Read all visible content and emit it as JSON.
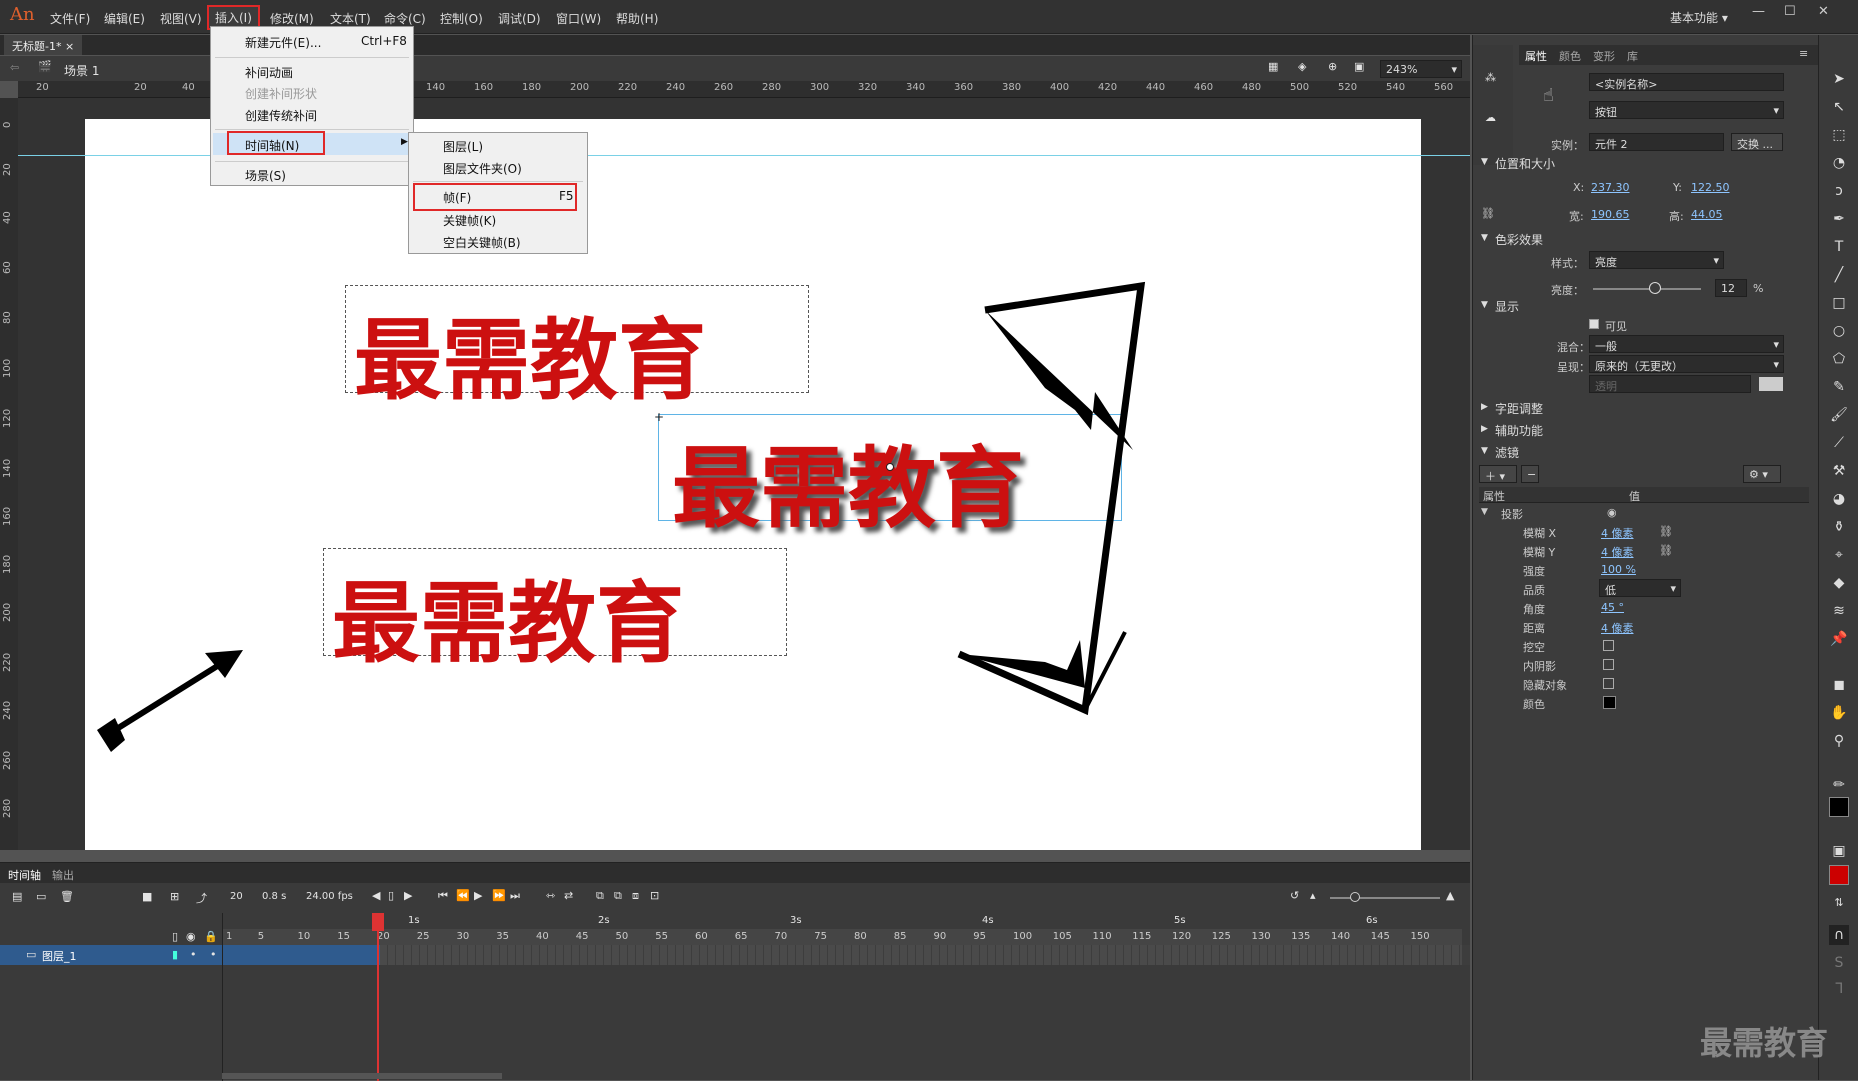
{
  "app": {
    "logo": "An"
  },
  "menubar": {
    "items": [
      "文件(F)",
      "编辑(E)",
      "视图(V)",
      "插入(I)",
      "修改(M)",
      "文本(T)",
      "命令(C)",
      "控制(O)",
      "调试(D)",
      "窗口(W)",
      "帮助(H)"
    ],
    "active": "插入(I)",
    "workspace": "基本功能"
  },
  "document": {
    "tab": "无标题-1*",
    "scene": "场景 1",
    "zoom": "243%"
  },
  "ruler": {
    "top": [
      "20",
      "20",
      "40",
      "140",
      "160",
      "180",
      "200",
      "220",
      "240",
      "260",
      "280",
      "300",
      "320",
      "340",
      "360",
      "380",
      "400",
      "420",
      "440",
      "460",
      "480",
      "500",
      "520",
      "540",
      "560"
    ],
    "left": [
      "0",
      "20",
      "40",
      "60",
      "80",
      "100",
      "120",
      "140",
      "160",
      "180",
      "200",
      "220",
      "240",
      "260",
      "280"
    ]
  },
  "insert_menu": {
    "items": [
      {
        "label": "新建元件(E)...",
        "shortcut": "Ctrl+F8"
      },
      {
        "label": "补间动画"
      },
      {
        "label": "创建补间形状",
        "disabled": true
      },
      {
        "label": "创建传统补间"
      },
      {
        "label": "时间轴(N)",
        "submenu": true
      },
      {
        "label": "场景(S)"
      }
    ]
  },
  "timeline_submenu": {
    "items": [
      {
        "label": "图层(L)"
      },
      {
        "label": "图层文件夹(O)"
      },
      {
        "label": "帧(F)",
        "shortcut": "F5"
      },
      {
        "label": "关键帧(K)"
      },
      {
        "label": "空白关键帧(B)"
      }
    ]
  },
  "stage": {
    "texts": [
      "最需教育",
      "最需教育",
      "最需教育"
    ]
  },
  "timeline": {
    "tabs": [
      "时间轴",
      "输出"
    ],
    "frame": "20",
    "time": "0.8 s",
    "fps": "24.00 fps",
    "seconds": [
      "1s",
      "2s",
      "3s",
      "4s",
      "5s",
      "6s"
    ],
    "frames": [
      "1",
      "5",
      "10",
      "15",
      "20",
      "25",
      "30",
      "35",
      "40",
      "45",
      "50",
      "55",
      "60",
      "65",
      "70",
      "75",
      "80",
      "85",
      "90",
      "95",
      "100",
      "105",
      "110",
      "115",
      "120",
      "125",
      "130",
      "135",
      "140",
      "145",
      "150"
    ],
    "layer": "图层_1"
  },
  "properties": {
    "tabs": [
      "属性",
      "颜色",
      "变形",
      "库"
    ],
    "instance_name_placeholder": "<实例名称>",
    "type": "按钮",
    "instance_label": "实例：",
    "instance_value": "元件 2",
    "swap_button": "交换 ...",
    "position_size": {
      "title": "位置和大小",
      "x_label": "X:",
      "x": "237.30",
      "y_label": "Y:",
      "y": "122.50",
      "w_label": "宽:",
      "w": "190.65",
      "h_label": "高:",
      "h": "44.05"
    },
    "color_effect": {
      "title": "色彩效果",
      "style_label": "样式：",
      "style": "亮度",
      "brightness_label": "亮度：",
      "brightness": "12",
      "brightness_unit": "%"
    },
    "display": {
      "title": "显示",
      "visible_label": "可见",
      "blend_label": "混合：",
      "blend": "一般",
      "render_label": "呈现：",
      "render": "原来的（无更改）",
      "transparent": "透明"
    },
    "sections": [
      "字距调整",
      "辅助功能",
      "滤镜"
    ],
    "filters": {
      "col_property": "属性",
      "col_value": "值",
      "filter_name": "投影",
      "rows": [
        {
          "label": "模糊 X",
          "value": "4 像素"
        },
        {
          "label": "模糊 Y",
          "value": "4 像素"
        },
        {
          "label": "强度",
          "value": "100 %"
        },
        {
          "label": "品质",
          "value": "低"
        },
        {
          "label": "角度",
          "value": "45 °"
        },
        {
          "label": "距离",
          "value": "4 像素"
        },
        {
          "label": "挖空",
          "value": ""
        },
        {
          "label": "内阴影",
          "value": ""
        },
        {
          "label": "隐藏对象",
          "value": ""
        },
        {
          "label": "颜色",
          "value": ""
        }
      ]
    }
  },
  "colors": {
    "accent_red": "#e02828",
    "stroke": "#000000",
    "fill": "#cc0000"
  },
  "watermark": "最需教育"
}
